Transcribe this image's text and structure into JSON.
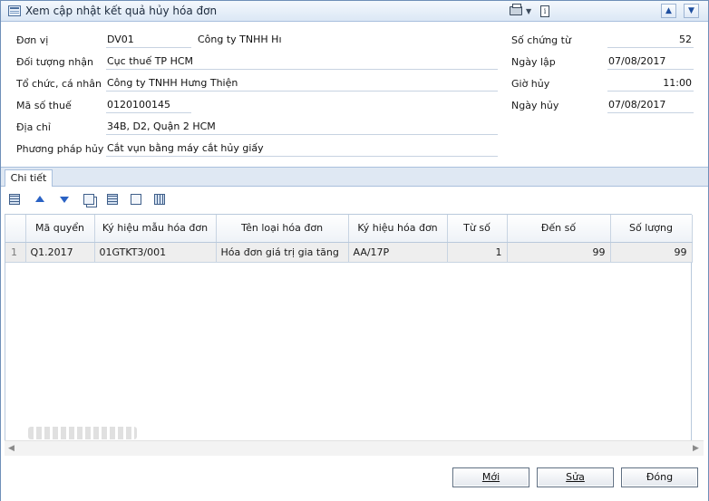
{
  "window": {
    "title": "Xem cập nhật kết quả hủy hóa đơn",
    "icons": [
      "form-icon",
      "printer-icon",
      "chevron-down-icon",
      "info-icon",
      "arrow-up-icon",
      "arrow-down-icon"
    ]
  },
  "form": {
    "don_vi": {
      "label": "Đơn vị",
      "code": "DV01",
      "name": "Công ty TNHH Hı"
    },
    "doi_tuong_nhan": {
      "label": "Đối tượng nhận",
      "value": "Cục thuế TP HCM"
    },
    "to_chuc_ca_nhan": {
      "label": "Tổ chức, cá nhân",
      "value": "Công ty TNHH Hưng Thiện"
    },
    "ma_so_thue": {
      "label": "Mã số thuế",
      "value": "0120100145"
    },
    "dia_chi": {
      "label": "Địa chỉ",
      "value": "34B, D2, Quận 2 HCM"
    },
    "phuong_phap_huy": {
      "label": "Phương pháp hủy",
      "value": "Cắt vụn bằng máy cắt hủy giấy"
    },
    "so_chung_tu": {
      "label": "Số chứng từ",
      "value": "52"
    },
    "ngay_lap": {
      "label": "Ngày lập",
      "value": "07/08/2017"
    },
    "gio_huy": {
      "label": "Giờ hủy",
      "value": "11:00"
    },
    "ngay_huy": {
      "label": "Ngày hủy",
      "value": "07/08/2017"
    }
  },
  "tabs": [
    {
      "label": "Chi tiết",
      "active": true
    }
  ],
  "toolbar": {
    "icons": [
      "grid-add-icon",
      "move-up-icon",
      "move-down-icon",
      "copy-row-icon",
      "delete-row-icon",
      "export-icon",
      "columns-icon"
    ]
  },
  "table": {
    "columns": [
      "Mã quyển",
      "Ký hiệu mẫu hóa đơn",
      "Tên loại hóa đơn",
      "Ký hiệu hóa đơn",
      "Từ số",
      "Đến số",
      "Số lượng"
    ],
    "rows": [
      {
        "index": "1",
        "ma_quyen": "Q1.2017",
        "ky_hieu_mau": "01GTKT3/001",
        "ten_loai": "Hóa đơn giá trị gia tăng",
        "ky_hieu_hd": "AA/17P",
        "tu_so": "1",
        "den_so": "99",
        "so_luong": "99"
      }
    ]
  },
  "buttons": {
    "new": {
      "label": "Mới"
    },
    "edit": {
      "label": "Sửa"
    },
    "close": {
      "label": "Đóng"
    }
  }
}
